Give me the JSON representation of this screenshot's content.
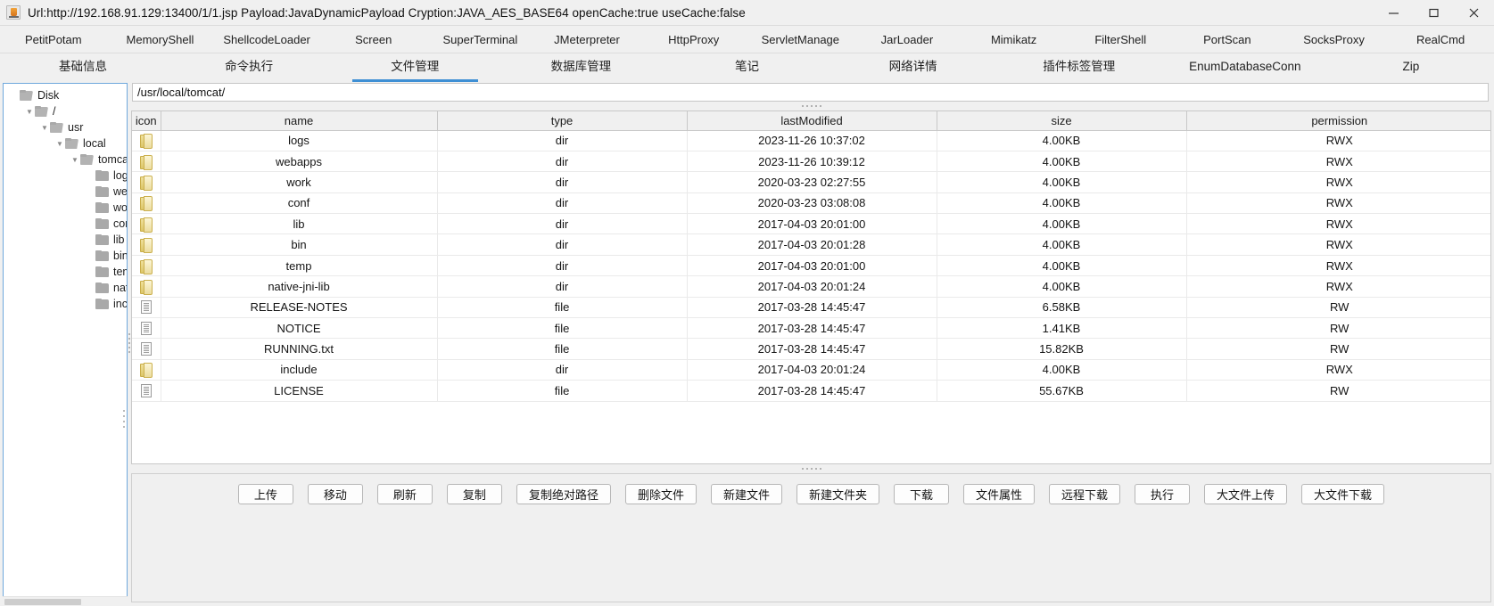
{
  "window": {
    "title": "Url:http://192.168.91.129:13400/1/1.jsp Payload:JavaDynamicPayload Cryption:JAVA_AES_BASE64 openCache:true useCache:false",
    "app_icon": "java-coffee-cup-icon",
    "controls": {
      "minimize": "minimize-icon",
      "maximize": "maximize-icon",
      "close": "close-icon"
    }
  },
  "plugin_tabs": [
    {
      "label": "PetitPotam"
    },
    {
      "label": "MemoryShell"
    },
    {
      "label": "ShellcodeLoader"
    },
    {
      "label": "Screen"
    },
    {
      "label": "SuperTerminal"
    },
    {
      "label": "JMeterpreter"
    },
    {
      "label": "HttpProxy"
    },
    {
      "label": "ServletManage"
    },
    {
      "label": "JarLoader"
    },
    {
      "label": "Mimikatz"
    },
    {
      "label": "FilterShell"
    },
    {
      "label": "PortScan"
    },
    {
      "label": "SocksProxy"
    },
    {
      "label": "RealCmd"
    }
  ],
  "function_tabs": [
    {
      "label": "基础信息",
      "active": false
    },
    {
      "label": "命令执行",
      "active": false
    },
    {
      "label": "文件管理",
      "active": true
    },
    {
      "label": "数据库管理",
      "active": false
    },
    {
      "label": "笔记",
      "active": false
    },
    {
      "label": "网络详情",
      "active": false
    },
    {
      "label": "插件标签管理",
      "active": false
    },
    {
      "label": "EnumDatabaseConn",
      "active": false
    },
    {
      "label": "Zip",
      "active": false
    }
  ],
  "active_tab_accent": "#3e8fd4",
  "tree": {
    "root_label": "Disk",
    "nodes": [
      {
        "label": "Disk",
        "depth": 0,
        "toggle": "",
        "icon": "folder-open-icon"
      },
      {
        "label": "/",
        "depth": 1,
        "toggle": "▼",
        "icon": "folder-open-icon"
      },
      {
        "label": "usr",
        "depth": 2,
        "toggle": "▼",
        "icon": "folder-open-icon"
      },
      {
        "label": "local",
        "depth": 3,
        "toggle": "▼",
        "icon": "folder-open-icon"
      },
      {
        "label": "tomcat",
        "depth": 4,
        "toggle": "▼",
        "icon": "folder-open-icon"
      },
      {
        "label": "logs",
        "depth": 5,
        "toggle": "",
        "icon": "folder-icon"
      },
      {
        "label": "weba",
        "depth": 5,
        "toggle": "",
        "icon": "folder-icon"
      },
      {
        "label": "work",
        "depth": 5,
        "toggle": "",
        "icon": "folder-icon"
      },
      {
        "label": "conf",
        "depth": 5,
        "toggle": "",
        "icon": "folder-icon"
      },
      {
        "label": "lib",
        "depth": 5,
        "toggle": "",
        "icon": "folder-icon"
      },
      {
        "label": "bin",
        "depth": 5,
        "toggle": "",
        "icon": "folder-icon"
      },
      {
        "label": "temp",
        "depth": 5,
        "toggle": "",
        "icon": "folder-icon"
      },
      {
        "label": "nativ",
        "depth": 5,
        "toggle": "",
        "icon": "folder-icon"
      },
      {
        "label": "inclu",
        "depth": 5,
        "toggle": "",
        "icon": "folder-icon"
      }
    ]
  },
  "path_input": {
    "value": "/usr/local/tomcat/",
    "placeholder": ""
  },
  "file_table": {
    "columns": [
      "icon",
      "name",
      "type",
      "lastModified",
      "size",
      "permission"
    ],
    "rows": [
      {
        "icon": "folder-icon",
        "name": "logs",
        "type": "dir",
        "lastModified": "2023-11-26 10:37:02",
        "size": "4.00KB",
        "permission": "RWX"
      },
      {
        "icon": "folder-icon",
        "name": "webapps",
        "type": "dir",
        "lastModified": "2023-11-26 10:39:12",
        "size": "4.00KB",
        "permission": "RWX"
      },
      {
        "icon": "folder-icon",
        "name": "work",
        "type": "dir",
        "lastModified": "2020-03-23 02:27:55",
        "size": "4.00KB",
        "permission": "RWX"
      },
      {
        "icon": "folder-icon",
        "name": "conf",
        "type": "dir",
        "lastModified": "2020-03-23 03:08:08",
        "size": "4.00KB",
        "permission": "RWX"
      },
      {
        "icon": "folder-icon",
        "name": "lib",
        "type": "dir",
        "lastModified": "2017-04-03 20:01:00",
        "size": "4.00KB",
        "permission": "RWX"
      },
      {
        "icon": "folder-icon",
        "name": "bin",
        "type": "dir",
        "lastModified": "2017-04-03 20:01:28",
        "size": "4.00KB",
        "permission": "RWX"
      },
      {
        "icon": "folder-icon",
        "name": "temp",
        "type": "dir",
        "lastModified": "2017-04-03 20:01:00",
        "size": "4.00KB",
        "permission": "RWX"
      },
      {
        "icon": "folder-icon",
        "name": "native-jni-lib",
        "type": "dir",
        "lastModified": "2017-04-03 20:01:24",
        "size": "4.00KB",
        "permission": "RWX"
      },
      {
        "icon": "file-icon",
        "name": "RELEASE-NOTES",
        "type": "file",
        "lastModified": "2017-03-28 14:45:47",
        "size": "6.58KB",
        "permission": "RW"
      },
      {
        "icon": "file-icon",
        "name": "NOTICE",
        "type": "file",
        "lastModified": "2017-03-28 14:45:47",
        "size": "1.41KB",
        "permission": "RW"
      },
      {
        "icon": "file-icon",
        "name": "RUNNING.txt",
        "type": "file",
        "lastModified": "2017-03-28 14:45:47",
        "size": "15.82KB",
        "permission": "RW"
      },
      {
        "icon": "folder-icon",
        "name": "include",
        "type": "dir",
        "lastModified": "2017-04-03 20:01:24",
        "size": "4.00KB",
        "permission": "RWX"
      },
      {
        "icon": "file-icon",
        "name": "LICENSE",
        "type": "file",
        "lastModified": "2017-03-28 14:45:47",
        "size": "55.67KB",
        "permission": "RW"
      }
    ]
  },
  "toolbar_buttons": [
    {
      "label": "上传"
    },
    {
      "label": "移动"
    },
    {
      "label": "刷新"
    },
    {
      "label": "复制"
    },
    {
      "label": "复制绝对路径"
    },
    {
      "label": "删除文件"
    },
    {
      "label": "新建文件"
    },
    {
      "label": "新建文件夹"
    },
    {
      "label": "下载"
    },
    {
      "label": "文件属性"
    },
    {
      "label": "远程下载"
    },
    {
      "label": "执行"
    },
    {
      "label": "大文件上传"
    },
    {
      "label": "大文件下载"
    }
  ]
}
